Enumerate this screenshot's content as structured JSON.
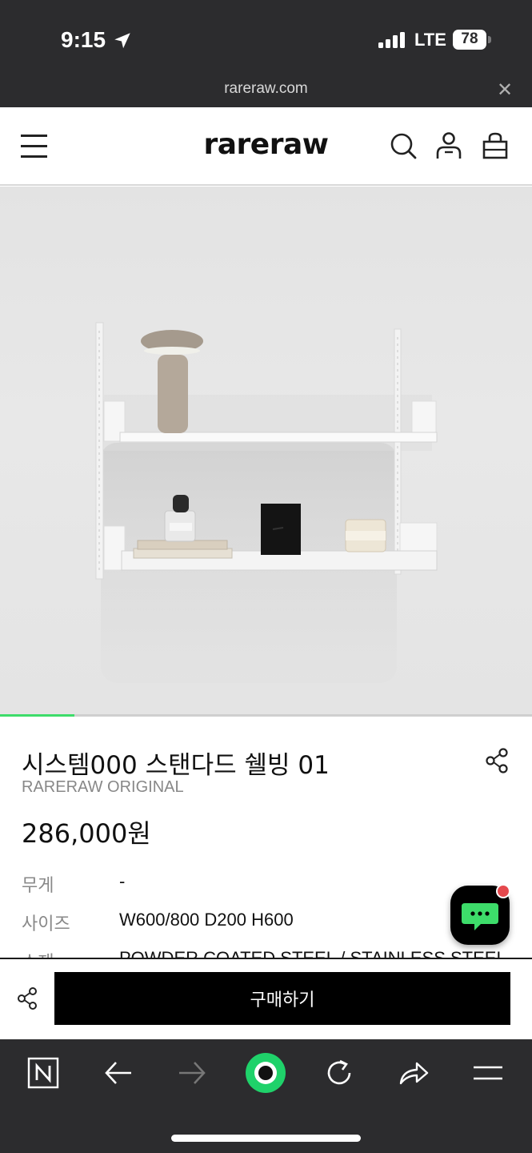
{
  "status_bar": {
    "time": "9:15",
    "network": "LTE",
    "battery": "78"
  },
  "url_bar": {
    "domain": "rareraw.com"
  },
  "header": {
    "logo": "rareraw",
    "icons": [
      "menu-icon",
      "search-icon",
      "user-icon",
      "shopping-bag-icon"
    ]
  },
  "hero": {
    "image_alt": "wall shelving unit with lamp, books, perfume bottle, clock and candle",
    "carousel_progress": 0.14
  },
  "product": {
    "title": "시스템000 스탠다드 쉘빙 01",
    "brand": "RARERAW ORIGINAL",
    "price": "286,000원",
    "specs": [
      {
        "label": "무게",
        "value": "-"
      },
      {
        "label": "사이즈",
        "value": "W600/800 D200 H600"
      },
      {
        "label": "소재",
        "value": "POWDER COATED STEEL / STAINLESS STEEL"
      }
    ]
  },
  "buy_bar": {
    "purchase_label": "구매하기"
  },
  "toolbar": {
    "icons": [
      "naver-n-icon",
      "back-arrow-icon",
      "forward-arrow-icon",
      "green-home-icon",
      "refresh-icon",
      "share-icon",
      "tabs-menu-icon"
    ]
  },
  "colors": {
    "accent_green": "#3ddc6a",
    "notification_red": "#e5484d",
    "chrome_dark": "#2c2c2e"
  }
}
